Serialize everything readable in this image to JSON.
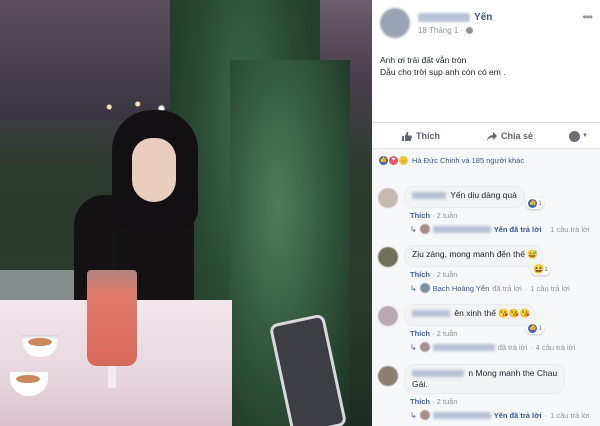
{
  "post": {
    "author_visible": "Yến",
    "timestamp": "18 Tháng 1 ·",
    "content_line1": "Anh ơi trái đất vẫn tròn",
    "content_line2": "Dẫu cho trời sụp anh còn có em .",
    "like_label": "Thích",
    "share_label": "Chia sẻ"
  },
  "reactions": {
    "summary": "Hà Đức Chinh và 185 người khác"
  },
  "comments": [
    {
      "text": "Yến dịu dàng quá",
      "reaction_count": "1",
      "like_label": "Thích",
      "time": "2 tuần",
      "reply_text": "Yến đã trả lời",
      "reply_count": "1 câu trả lời"
    },
    {
      "text": "Zịu zàng, mong manh đến thế 😅",
      "reaction_count": "1",
      "like_label": "Thích",
      "time": "2 tuần",
      "reply_name": "Bạch Hoàng Yến",
      "reply_text": "đã trả lời",
      "reply_count": "1 câu trả lời"
    },
    {
      "text": "ên xinh thế 😘😘😘",
      "reaction_count": "1",
      "like_label": "Thích",
      "time": "2 tuần",
      "reply_text": "đã trả lời",
      "reply_count": "4 câu trả lời"
    },
    {
      "text_line1": "n Mong manh the Chau",
      "text_line2": "Gái.",
      "like_label": "Thích",
      "time": "2 tuần",
      "reply_text": "Yến đã trả lời",
      "reply_count": "1 câu trả lời"
    }
  ],
  "icons": {
    "like": "thumbs-up-icon",
    "share": "share-arrow-icon",
    "more": "ellipsis-icon",
    "reply_arrow": "reply-arrow-icon"
  },
  "colors": {
    "link_blue": "#365899",
    "accent_blue": "#4267b2",
    "meta_gray": "#90949c"
  }
}
